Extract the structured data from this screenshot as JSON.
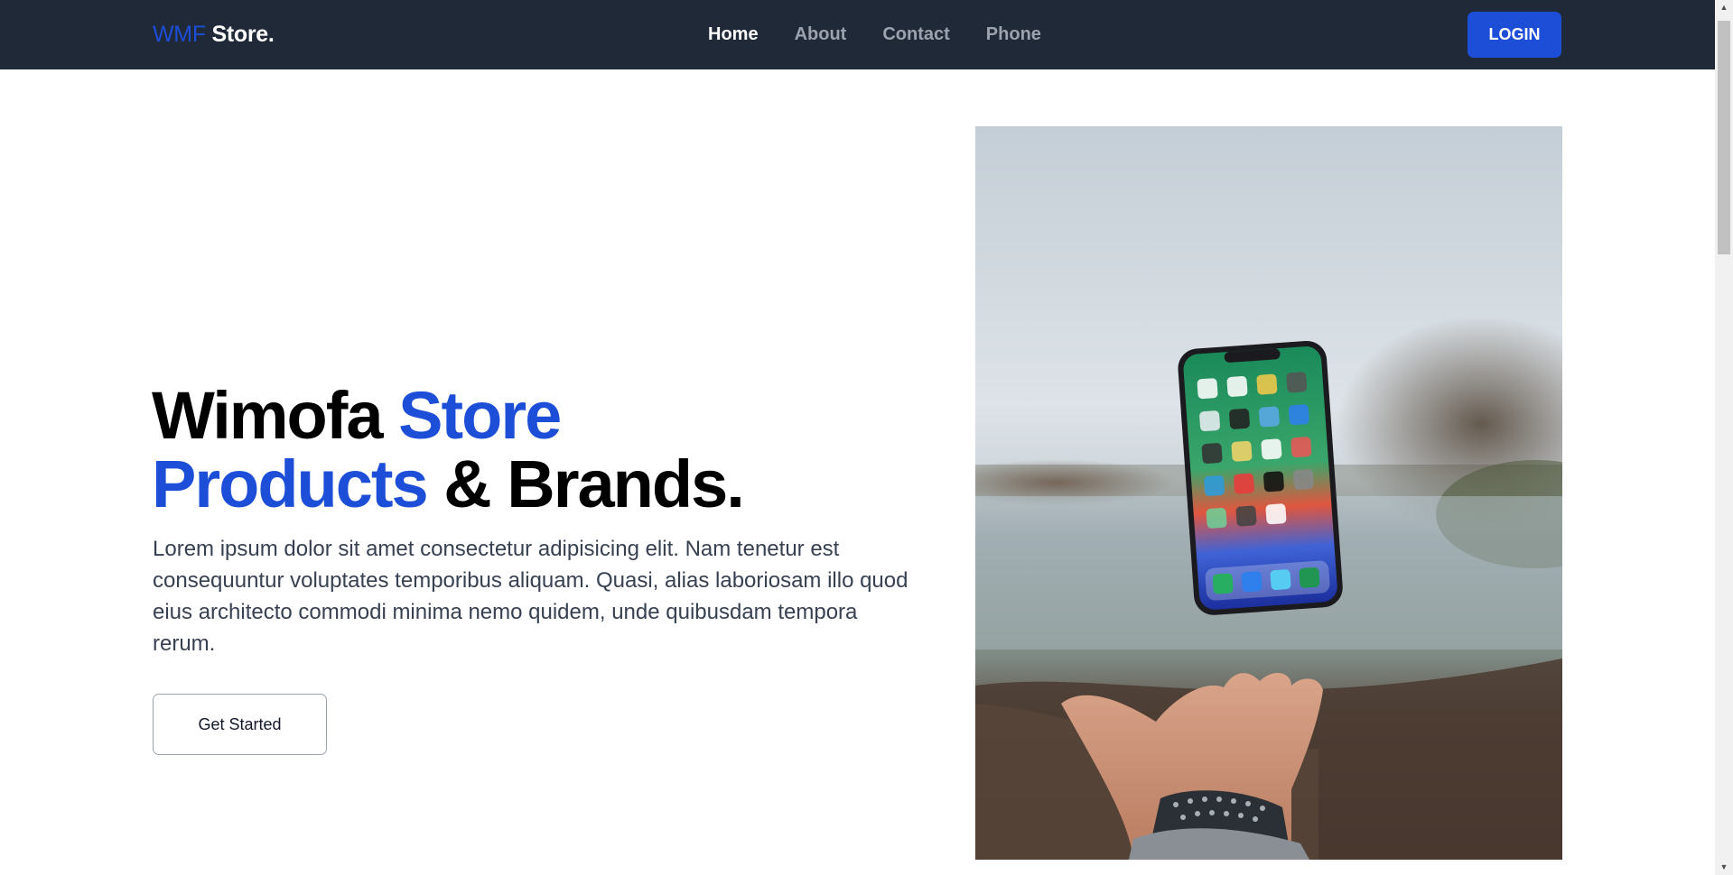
{
  "header": {
    "brand": {
      "part1": "WMF",
      "part2": " Store."
    },
    "nav": [
      {
        "label": "Home",
        "active": true
      },
      {
        "label": "About",
        "active": false
      },
      {
        "label": "Contact",
        "active": false
      },
      {
        "label": "Phone",
        "active": false
      }
    ],
    "login_label": "LOGIN"
  },
  "hero": {
    "title": {
      "part1": "Wimofa ",
      "part2": "Store",
      "part3": "Products",
      "part4": " & Brands."
    },
    "description": "Lorem ipsum dolor sit amet consectetur adipisicing elit. Nam tenetur est consequuntur voluptates temporibus aliquam. Quasi, alias laboriosam illo quod eius architecto commodi minima nemo quidem, unde quibusdam tempora rerum.",
    "cta_label": "Get Started",
    "image_subject": "hand-with-floating-smartphone-photo"
  },
  "colors": {
    "navbar_bg": "#1f2937",
    "accent": "#1d4ed8",
    "nav_inactive": "#9ca3af",
    "text_dark": "#000000"
  },
  "icons": {
    "scroll_up": "scroll-up-arrow-icon",
    "scroll_down": "scroll-down-arrow-icon"
  }
}
